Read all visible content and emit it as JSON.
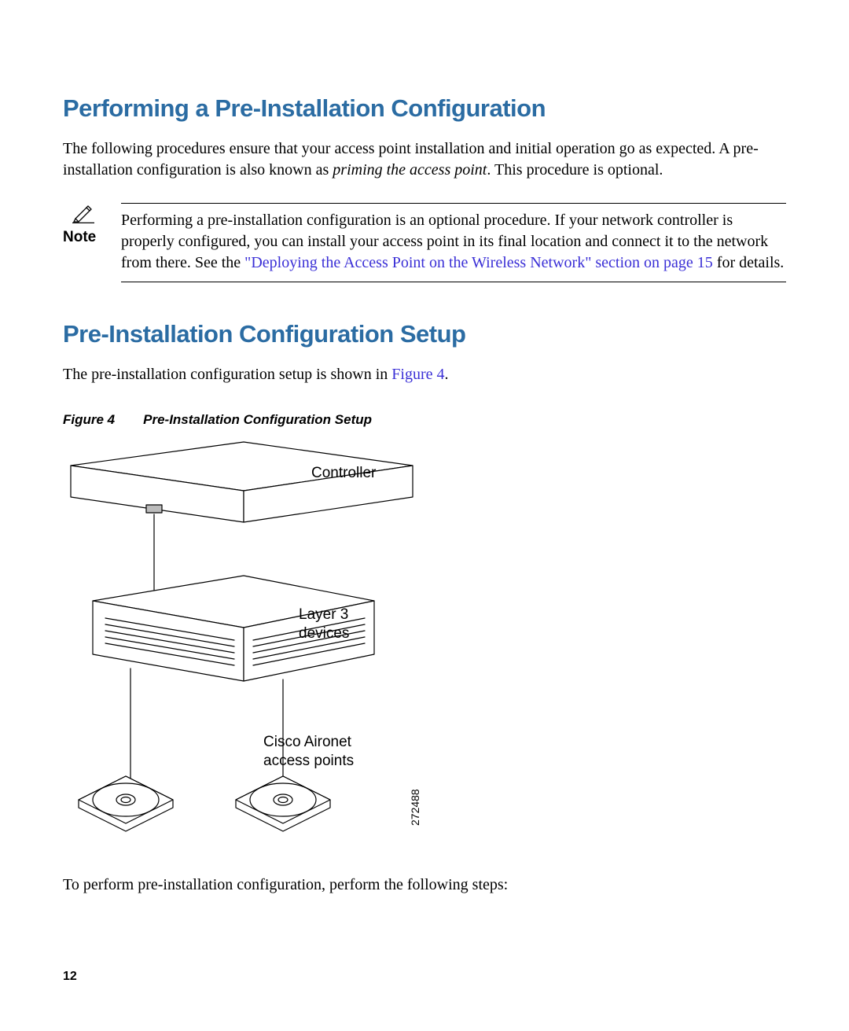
{
  "section1": {
    "heading": "Performing a Pre-Installation Configuration",
    "intro_1": "The following procedures ensure that your access point installation and initial operation go as expected. A pre-installation configuration is also known as ",
    "intro_italic": "priming the access point",
    "intro_2": ". This procedure is optional."
  },
  "note": {
    "label": "Note",
    "body_1": "Performing a pre-installation configuration is an optional procedure. If your network controller is properly configured, you can install your access point in its final location and connect it to the network from there. See the ",
    "link": "\"Deploying the Access Point on the Wireless Network\" section on page 15",
    "body_2": " for details."
  },
  "section2": {
    "heading": "Pre-Installation Configuration Setup",
    "intro_1": "The pre-installation configuration setup is shown in ",
    "link": "Figure 4",
    "intro_2": "."
  },
  "figure": {
    "num": "Figure 4",
    "title": "Pre-Installation Configuration Setup",
    "labels": {
      "controller": "Controller",
      "layer3": "Layer 3\ndevices",
      "aps": "Cisco Aironet\naccess points"
    },
    "diagram_id": "272488"
  },
  "closing": "To perform pre-installation configuration, perform the following steps:",
  "page_number": "12"
}
